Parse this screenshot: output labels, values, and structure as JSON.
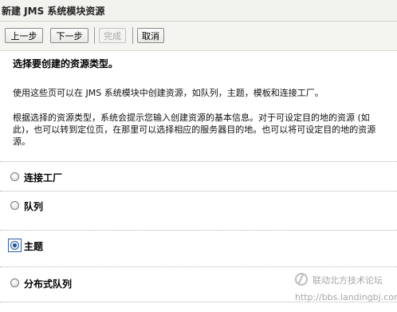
{
  "window": {
    "title": "新建 JMS 系统模块资源"
  },
  "toolbar": {
    "back_label": "上一步",
    "next_label": "下一步",
    "finish_label": "完成",
    "cancel_label": "取消"
  },
  "main": {
    "heading": "选择要创建的资源类型。",
    "paragraph1": "使用这些页可以在 JMS 系统模块中创建资源，如队列，主题，模板和连接工厂。",
    "paragraph2_line1": "根据选择的资源类型，系统会提示您输入创建资源的基本信息。对于可设定目的地的资源 (如",
    "paragraph2_line2": "此)，也可以转到定位页，在那里可以选择相应的服务器目的地。也可以将可设定目的地的资源",
    "paragraph2_line3": "源。"
  },
  "options": [
    {
      "label": "连接工厂",
      "selected": false
    },
    {
      "label": "队列",
      "selected": false
    },
    {
      "label": "主题",
      "selected": true
    },
    {
      "label": "分布式队列",
      "selected": false
    }
  ],
  "watermark": {
    "name": "联动北方技术论坛",
    "url": "http://bbs.landingbj.com"
  }
}
